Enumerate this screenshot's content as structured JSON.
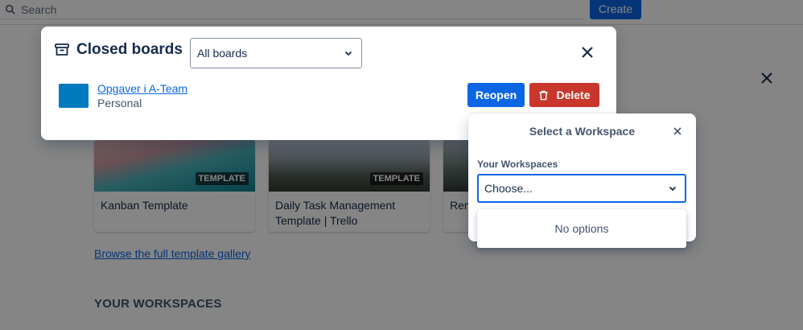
{
  "background": {
    "search_placeholder": "Search",
    "create_label": "Create",
    "templates": [
      {
        "title": "Kanban Template",
        "badge": "TEMPLATE"
      },
      {
        "title": "Daily Task Management Template | Trello",
        "badge": "TEMPLATE"
      },
      {
        "title": "Rem",
        "badge": ""
      }
    ],
    "browse_link": "Browse the full template gallery",
    "workspaces_heading": "YOUR WORKSPACES"
  },
  "closed_boards_modal": {
    "title": "Closed boards",
    "title_icon": "archive-icon",
    "filter_value": "All boards",
    "boards": [
      {
        "name": "Opgaver i A-Team",
        "workspace": "Personal",
        "color": "#0079bf"
      }
    ],
    "reopen_label": "Reopen",
    "delete_label": "Delete"
  },
  "workspace_popover": {
    "title": "Select a Workspace",
    "field_label": "Your Workspaces",
    "select_placeholder": "Choose...",
    "no_options_text": "No options"
  },
  "colors": {
    "primary": "#0c66e4",
    "danger": "#c9372c",
    "board_swatch": "#0079bf"
  }
}
